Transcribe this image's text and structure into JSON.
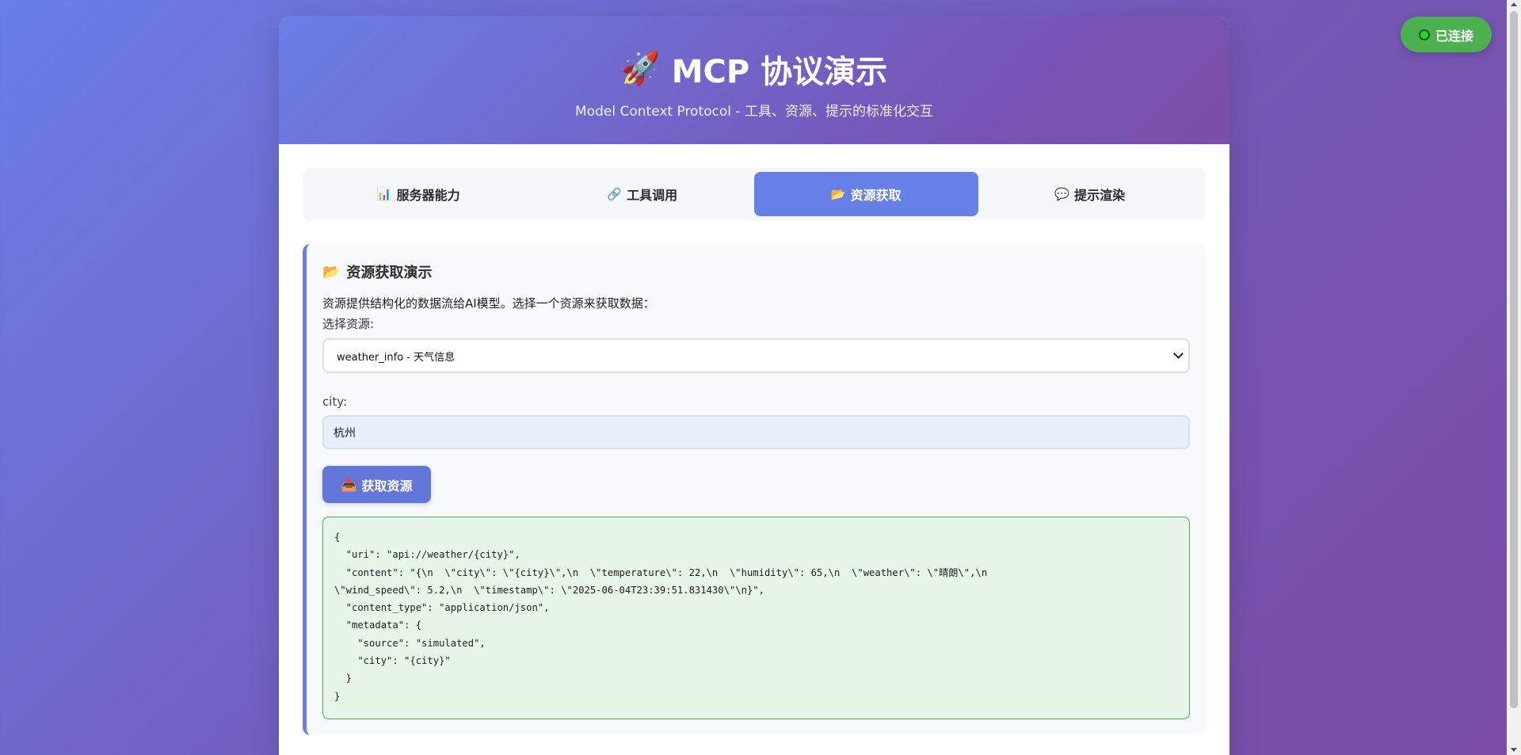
{
  "connection": {
    "status_label": "已连接",
    "status_color": "#4caf50"
  },
  "header": {
    "title": "MCP 协议演示",
    "icon": "rocket-icon",
    "subtitle": "Model Context Protocol - 工具、资源、提示的标准化交互"
  },
  "tabs": [
    {
      "icon": "📊",
      "label": "服务器能力",
      "active": false
    },
    {
      "icon": "🔗",
      "label": "工具调用",
      "active": false
    },
    {
      "icon": "📂",
      "label": "资源获取",
      "active": true
    },
    {
      "icon": "💬",
      "label": "提示渲染",
      "active": false
    }
  ],
  "panel": {
    "title_icon": "📂",
    "title": "资源获取演示",
    "description": "资源提供结构化的数据流给AI模型。选择一个资源来获取数据：",
    "select_label": "选择资源:",
    "selected_resource": "weather_info - 天气信息",
    "city_label": "city:",
    "city_value": "杭州",
    "fetch_button_icon": "📥",
    "fetch_button_label": "获取资源",
    "result_text": "{\n  \"uri\": \"api://weather/{city}\",\n  \"content\": \"{\\n  \\\"city\\\": \\\"{city}\\\",\\n  \\\"temperature\\\": 22,\\n  \\\"humidity\\\": 65,\\n  \\\"weather\\\": \\\"晴朗\\\",\\n\n\\\"wind_speed\\\": 5.2,\\n  \\\"timestamp\\\": \\\"2025-06-04T23:39:51.831430\\\"\\n}\",\n  \"content_type\": \"application/json\",\n  \"metadata\": {\n    \"source\": \"simulated\",\n    \"city\": \"{city}\"\n  }\n}"
  },
  "colors": {
    "accent": "#6780e8",
    "button": "#6377d9",
    "result_bg": "#e8f5e9",
    "result_border": "#4caf50"
  }
}
